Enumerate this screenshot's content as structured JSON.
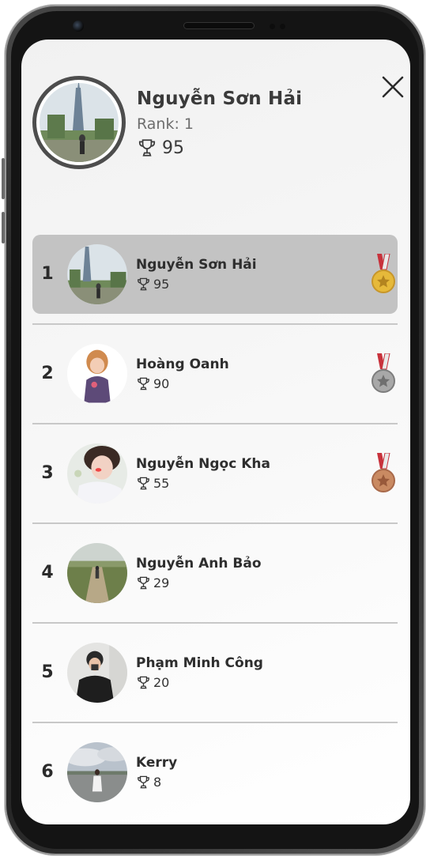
{
  "colors": {
    "highlight_row": "#c3c3c3",
    "gold": "#e6b93a",
    "silver": "#9a9a9a",
    "bronze": "#c98a62",
    "ribbon": "#c8323c"
  },
  "header": {
    "close_icon": "close-icon",
    "user": {
      "name": "Nguyễn Sơn Hải",
      "rank_text": "Rank: 1",
      "score": "95",
      "trophy_icon": "trophy-icon"
    }
  },
  "leaderboard": [
    {
      "rank": "1",
      "name": "Nguyễn Sơn Hải",
      "score": "95",
      "medal": "gold-medal-icon",
      "highlight": true
    },
    {
      "rank": "2",
      "name": "Hoàng Oanh",
      "score": "90",
      "medal": "silver-medal-icon",
      "highlight": false
    },
    {
      "rank": "3",
      "name": "Nguyễn Ngọc Kha",
      "score": "55",
      "medal": "bronze-medal-icon",
      "highlight": false
    },
    {
      "rank": "4",
      "name": "Nguyễn Anh Bảo",
      "score": "29",
      "medal": "",
      "highlight": false
    },
    {
      "rank": "5",
      "name": "Phạm Minh Công",
      "score": "20",
      "medal": "",
      "highlight": false
    },
    {
      "rank": "6",
      "name": "Kerry",
      "score": "8",
      "medal": "",
      "highlight": false
    }
  ]
}
